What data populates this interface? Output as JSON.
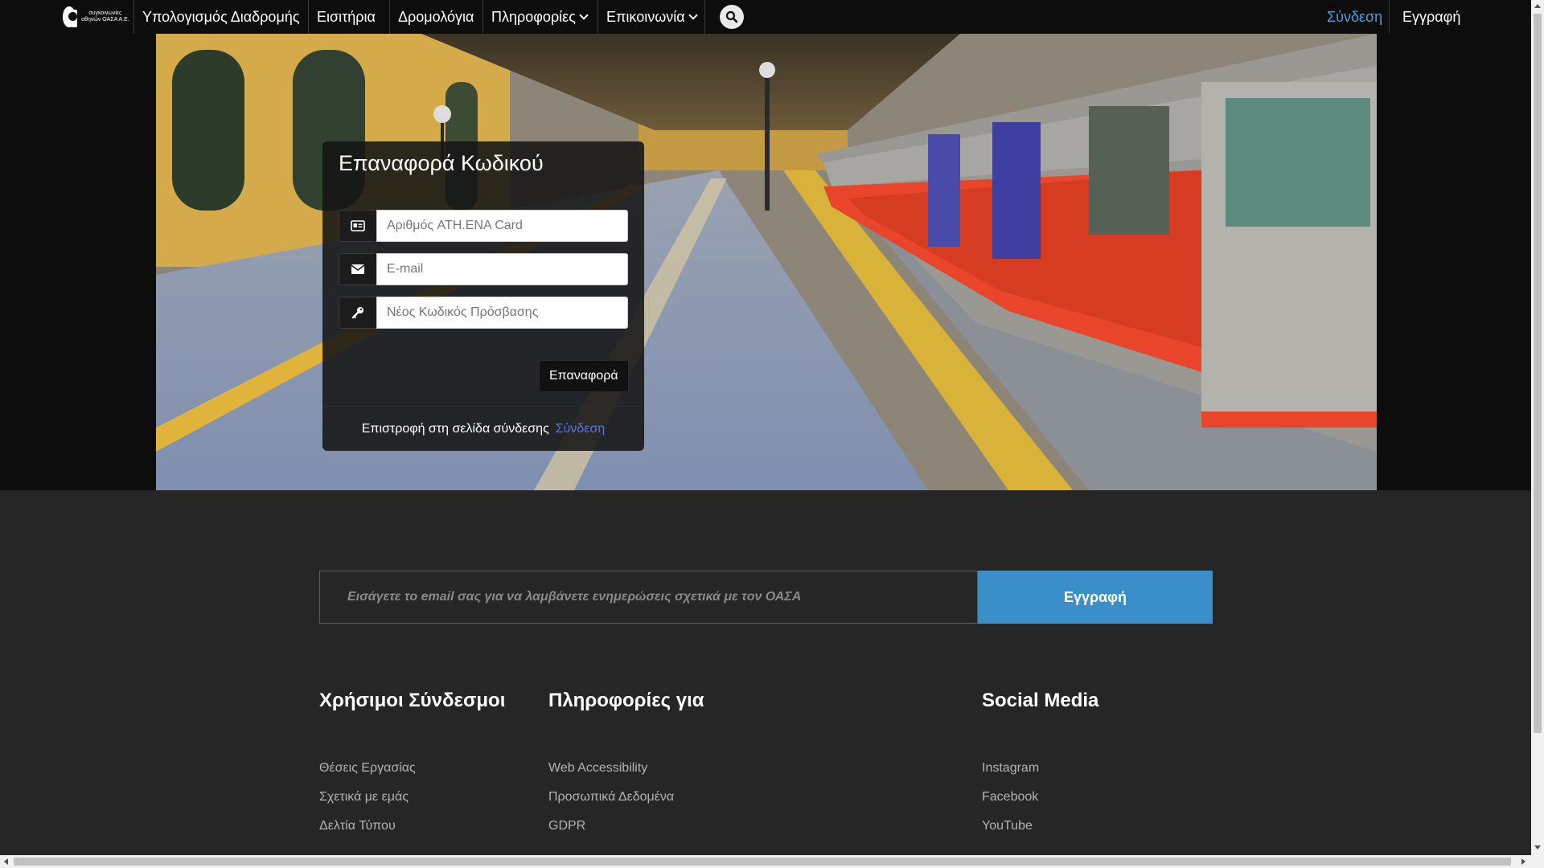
{
  "nav": {
    "logo_text": "συγκοινωνίες αθηνών ΟΑΣΑ Α.Ε.",
    "items": [
      {
        "label": "Υπολογισμός Διαδρομής",
        "dropdown": false
      },
      {
        "label": "Εισιτήρια",
        "dropdown": false
      },
      {
        "label": "Δρομολόγια",
        "dropdown": false
      },
      {
        "label": "Πληροφορίες",
        "dropdown": true
      },
      {
        "label": "Επικοινωνία",
        "dropdown": true
      }
    ],
    "search_icon": "search-icon",
    "login": "Σύνδεση",
    "register": "Εγγραφή"
  },
  "reset": {
    "title": "Επαναφορά Κωδικού",
    "card_placeholder": "Αριθμός ATH.ENA Card",
    "email_placeholder": "E-mail",
    "password_placeholder": "Νέος Κωδικός Πρόσβασης",
    "submit": "Επαναφορά",
    "back_text": "Επιστροφή στη σελίδα σύνδεσης",
    "back_link": "Σύνδεση"
  },
  "newsletter": {
    "placeholder": "Εισάγετε το email σας για να λαμβάνετε ενημερώσεις σχετικά με τον ΟΑΣΑ",
    "button": "Εγγραφή"
  },
  "footer": {
    "useful": {
      "title": "Χρήσιμοι Σύνδεσμοι",
      "links": [
        "Θέσεις Εργασίας",
        "Σχετικά με εμάς",
        "Δελτία Τύπου"
      ]
    },
    "info": {
      "title": "Πληροφορίες για",
      "links": [
        "Web Accessibility",
        "Προσωπικά Δεδομένα",
        "GDPR"
      ]
    },
    "social": {
      "title": "Social Media",
      "links": [
        "Instagram",
        "Facebook",
        "YouTube"
      ]
    }
  },
  "colors": {
    "accent": "#3b8fc8",
    "login_link": "#4aa3df",
    "back_link": "#5b73e8",
    "nav_bg": "#0d0d0d",
    "page_bg": "#262626"
  }
}
